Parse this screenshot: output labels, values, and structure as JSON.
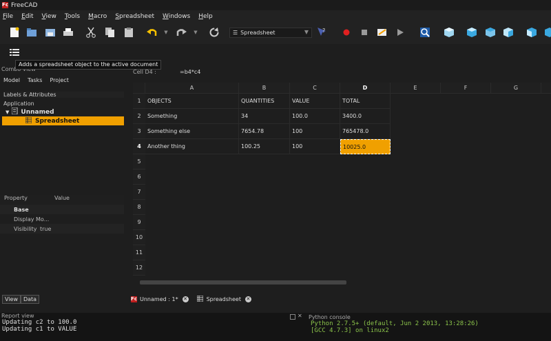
{
  "window": {
    "title": "FreeCAD",
    "logo": "Fc"
  },
  "menu": [
    "File",
    "Edit",
    "View",
    "Tools",
    "Macro",
    "Spreadsheet",
    "Windows",
    "Help"
  ],
  "toolbar": {
    "workbench": "Spreadsheet"
  },
  "tooltip": "Adds a spreadsheet object to the active document",
  "combo": {
    "header": "Combo View",
    "tabs": [
      "Model",
      "Tasks",
      "Project"
    ],
    "labels_attributes": "Labels & Attributes",
    "application": "Application",
    "tree": {
      "doc": "Unnamed",
      "item": "Spreadsheet"
    },
    "props": {
      "header_property": "Property",
      "header_value": "Value",
      "group": "Base",
      "rows": [
        {
          "name": "Display Mo...",
          "value": ""
        },
        {
          "name": "Visibility",
          "value": "true"
        }
      ]
    },
    "bottom_tabs": [
      "View",
      "Data"
    ]
  },
  "cellbar": {
    "label": "Cell D4 :",
    "formula": "=b4*c4"
  },
  "sheet": {
    "columns": [
      "A",
      "B",
      "C",
      "D",
      "E",
      "F",
      "G"
    ],
    "rows": [
      "1",
      "2",
      "3",
      "4",
      "5",
      "6",
      "7",
      "8",
      "9",
      "10",
      "11",
      "12"
    ],
    "cells": [
      [
        "OBJECTS",
        "QUANTITIES",
        "VALUE",
        "TOTAL"
      ],
      [
        "Something",
        "34",
        "100.0",
        "3400.0"
      ],
      [
        "Something else",
        "7654.78",
        "100",
        "765478.0"
      ],
      [
        "Another thing",
        "100.25",
        "100",
        "10025.0"
      ]
    ]
  },
  "doctabs": [
    "Unnamed : 1*",
    "Spreadsheet"
  ],
  "report": {
    "title": "Report view",
    "lines": [
      "Updating c2 to 100.0",
      "Updating c1 to VALUE"
    ]
  },
  "python": {
    "title": "Python console",
    "lines": [
      "Python 2.7.5+ (default, Jun  2 2013, 13:28:26)",
      "[GCC 4.7.3] on linux2"
    ]
  }
}
